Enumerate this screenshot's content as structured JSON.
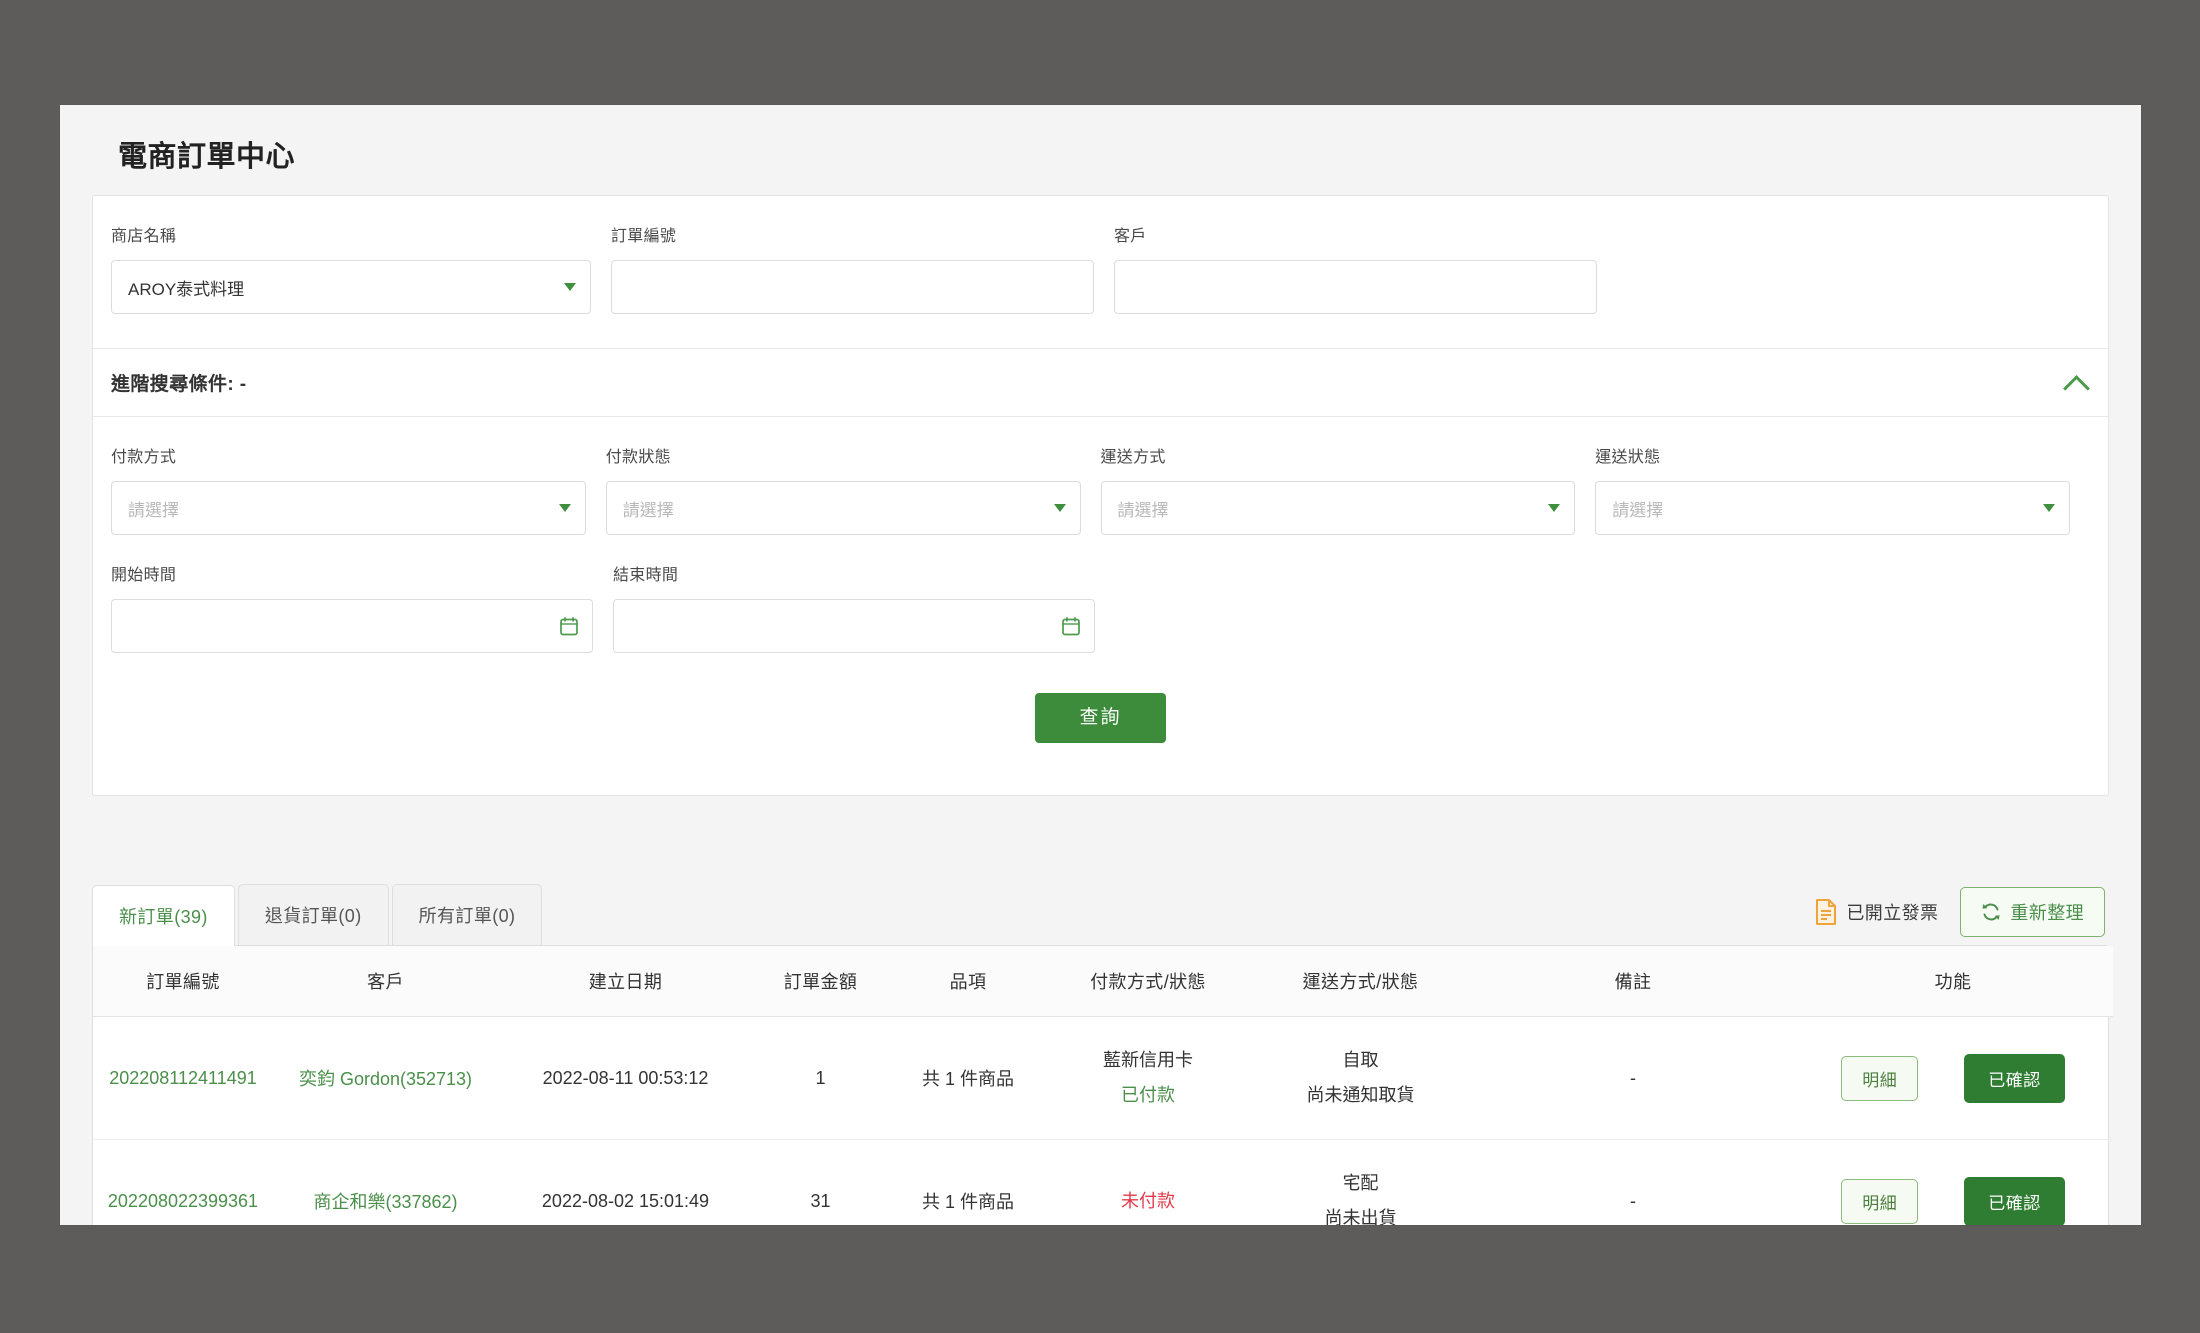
{
  "page": {
    "title": "電商訂單中心"
  },
  "search": {
    "basic_fields": [
      {
        "label": "商店名稱",
        "type": "select",
        "value": "AROY泰式料理",
        "placeholder": ""
      },
      {
        "label": "訂單編號",
        "type": "text",
        "value": "",
        "placeholder": ""
      },
      {
        "label": "客戶",
        "type": "text",
        "value": "",
        "placeholder": ""
      }
    ],
    "advanced_title": "進階搜尋條件: -",
    "advanced_fields": [
      {
        "label": "付款方式",
        "type": "select",
        "value": "",
        "placeholder": "請選擇"
      },
      {
        "label": "付款狀態",
        "type": "select",
        "value": "",
        "placeholder": "請選擇"
      },
      {
        "label": "運送方式",
        "type": "select",
        "value": "",
        "placeholder": "請選擇"
      },
      {
        "label": "運送狀態",
        "type": "select",
        "value": "",
        "placeholder": "請選擇"
      }
    ],
    "date_fields": [
      {
        "label": "開始時間",
        "type": "date",
        "value": "",
        "placeholder": ""
      },
      {
        "label": "結束時間",
        "type": "date",
        "value": "",
        "placeholder": ""
      }
    ],
    "submit_label": "查詢"
  },
  "list": {
    "tabs": [
      {
        "label": "新訂單(39)",
        "active": true
      },
      {
        "label": "退貨訂單(0)",
        "active": false
      },
      {
        "label": "所有訂單(0)",
        "active": false
      }
    ],
    "toolbar": {
      "invoice_label": "已開立發票",
      "refresh_label": "重新整理"
    },
    "columns": [
      "訂單編號",
      "客戶",
      "建立日期",
      "訂單金額",
      "品項",
      "付款方式/狀態",
      "運送方式/狀態",
      "備註",
      "功能"
    ],
    "rows": [
      {
        "order_no": "202208112411491",
        "customer": "奕鈞 Gordon(352713)",
        "created_at": "2022-08-11 00:53:12",
        "amount": "1",
        "items": "共 1 件商品",
        "pay_method": "藍新信用卡",
        "pay_status": "已付款",
        "pay_status_state": "paid",
        "ship_method": "自取",
        "ship_status": "尚未通知取貨",
        "note": "-",
        "detail_label": "明細",
        "confirm_label": "已確認"
      },
      {
        "order_no": "202208022399361",
        "customer": "商企和樂(337862)",
        "created_at": "2022-08-02 15:01:49",
        "amount": "31",
        "items": "共 1 件商品",
        "pay_method": "",
        "pay_status": "未付款",
        "pay_status_state": "unpaid",
        "ship_method": "宅配",
        "ship_status": "尚未出貨",
        "note": "-",
        "detail_label": "明細",
        "confirm_label": "已確認"
      }
    ]
  },
  "colors": {
    "brand_green": "#3c8c3c",
    "link_green": "#4a8f4a",
    "danger_red": "#e13a4c",
    "invoice_orange": "#f0a23c",
    "desktop_gray": "#5d5c5b"
  }
}
